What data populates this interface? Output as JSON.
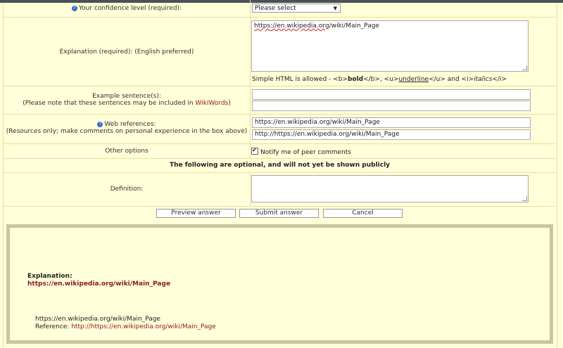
{
  "confidence": {
    "label": "Your confidence level (required):",
    "select_value": "Please select"
  },
  "explanation": {
    "label": "Explanation (required): (English preferred)",
    "text_pre": "https",
    "text_link": "://en.wikipedia.org",
    "text_post": "/wiki/Main_Page",
    "hint_pre": "Simple HTML is allowed - <b>",
    "hint_bold": "bold",
    "hint_mid1": "</b>, <u>",
    "hint_underline": "underline",
    "hint_mid2": "</u> and <i>",
    "hint_italic": "italics",
    "hint_post": "</i>"
  },
  "examples": {
    "label": "Example sentence(s):",
    "note_pre": "(Please note that these sentences may be included in ",
    "note_link": "WikiWords",
    "note_post": ")"
  },
  "web_refs": {
    "label": "Web references:",
    "note": "(Resources only; make comments on personal experience in the box above)",
    "value1": "https://en.wikipedia.org/wiki/Main_Page",
    "value2": "http://https://en.wikipedia.org/wiki/Main_Page"
  },
  "options": {
    "label": "Other options",
    "notify": "Notify me of peer comments"
  },
  "optional_header": "The following are optional, and will not yet be shown publicly",
  "definition": {
    "label": "Definition:"
  },
  "buttons": {
    "preview": "Preview answer",
    "submit": "Submit answer",
    "cancel": "Cancel"
  },
  "preview": {
    "title": "Explanation:",
    "link": "https://en.wikipedia.org/wiki/Main_Page",
    "ref_line": "https://en.wikipedia.org/wiki/Main_Page",
    "ref_label": "Reference: ",
    "ref_link": "http://https://en.wikipedia.org/wiki/Main_Page"
  }
}
